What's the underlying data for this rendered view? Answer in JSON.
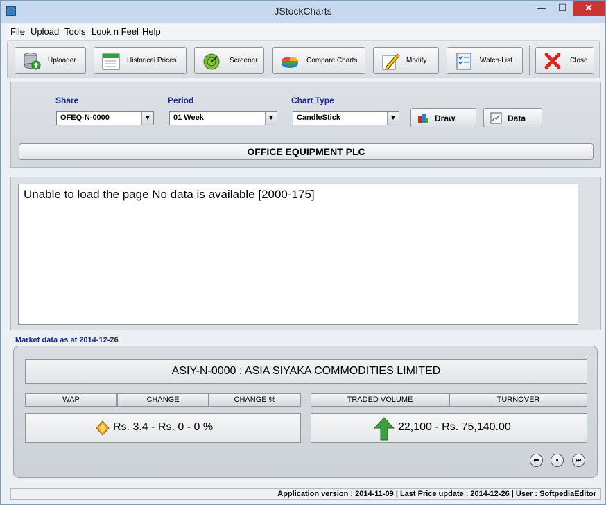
{
  "window": {
    "title": "JStockCharts"
  },
  "titlebar": {
    "minimize": "—",
    "maximize": "☐",
    "close": "✕"
  },
  "menu": [
    "File",
    "Upload",
    "Tools",
    "Look n Feel",
    "Help"
  ],
  "toolbar": {
    "uploader": "Uploader",
    "historical_prices": "Historical Prices",
    "screener": "Screener",
    "compare_charts": "Compare Charts",
    "modify": "Modify",
    "watch_list": "Watch-List",
    "close": "Close"
  },
  "selection": {
    "share_label": "Share",
    "share_value": "OFEQ-N-0000",
    "period_label": "Period",
    "period_value": "01 Week",
    "chart_type_label": "Chart Type",
    "chart_type_value": "CandleStick",
    "draw_button": "Draw",
    "data_button": "Data",
    "company_name": "OFFICE EQUIPMENT PLC"
  },
  "content": {
    "message": "Unable to load the page No data is available [2000-175]"
  },
  "market": {
    "date_label": "Market data as at 2014-12-26",
    "stock_title": "ASIY-N-0000 : ASIA SIYAKA COMMODITIES LIMITED",
    "headers": [
      "WAP",
      "CHANGE",
      "CHANGE %",
      "TRADED VOLUME",
      "TURNOVER"
    ],
    "price_text": "Rs. 3.4  -  Rs. 0  -  0 %",
    "volume_text": "22,100  -  Rs. 75,140.00",
    "controls": {
      "prev": "⏮",
      "pause": "⏸",
      "next": "⏭"
    }
  },
  "status": {
    "text": "Application version : 2014-11-09  |  Last Price update : 2014-12-26  |  User : SoftpediaEditor"
  }
}
